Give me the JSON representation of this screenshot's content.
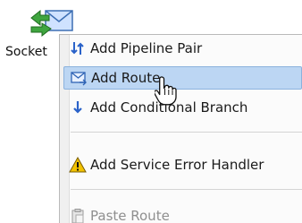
{
  "node": {
    "label": "Socket",
    "icon": "socket-envelope-arrows-icon"
  },
  "context_menu": {
    "items": [
      {
        "label": "Add Pipeline Pair",
        "icon": "pipeline-pair-icon",
        "state": "normal"
      },
      {
        "label": "Add Route",
        "icon": "route-envelope-icon",
        "state": "hover"
      },
      {
        "label": "Add Conditional Branch",
        "icon": "branch-arrow-icon",
        "state": "normal"
      },
      {
        "label": "Add Service Error Handler",
        "icon": "warning-triangle-icon",
        "state": "normal"
      },
      {
        "label": "Paste Route",
        "icon": "paste-icon",
        "state": "disabled"
      }
    ]
  },
  "colors": {
    "hover_bg": "#bcd6f3",
    "hover_border": "#8bb2dd",
    "disabled_text": "#8f8f8f",
    "warning": "#f2c200"
  }
}
